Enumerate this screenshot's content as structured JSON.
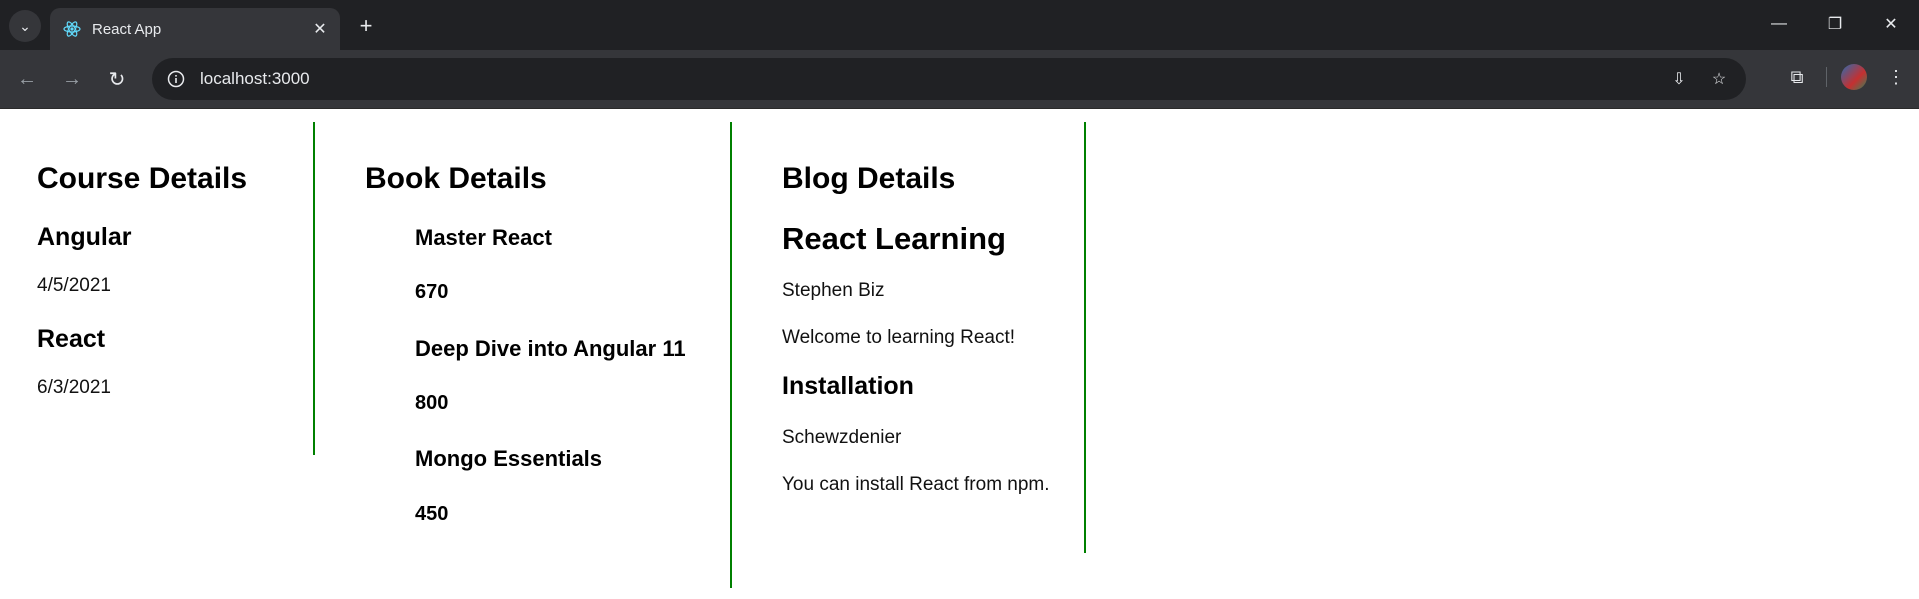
{
  "browser": {
    "tab_title": "React App",
    "url": "localhost:3000"
  },
  "courses": {
    "heading": "Course Details",
    "items": [
      {
        "name": "Angular",
        "date": "4/5/2021"
      },
      {
        "name": "React",
        "date": "6/3/2021"
      }
    ]
  },
  "books": {
    "heading": "Book Details",
    "items": [
      {
        "name": "Master React",
        "price": "670"
      },
      {
        "name": "Deep Dive into Angular 11",
        "price": "800"
      },
      {
        "name": "Mongo Essentials",
        "price": "450"
      }
    ]
  },
  "blogs": {
    "heading": "Blog Details",
    "items": [
      {
        "title": "React Learning",
        "author": "Stephen Biz",
        "content": "Welcome to learning React!"
      },
      {
        "title": "Installation",
        "author": "Schewzdenier",
        "content": "You can install React from npm."
      }
    ]
  },
  "colors": {
    "divider": "#008000"
  }
}
